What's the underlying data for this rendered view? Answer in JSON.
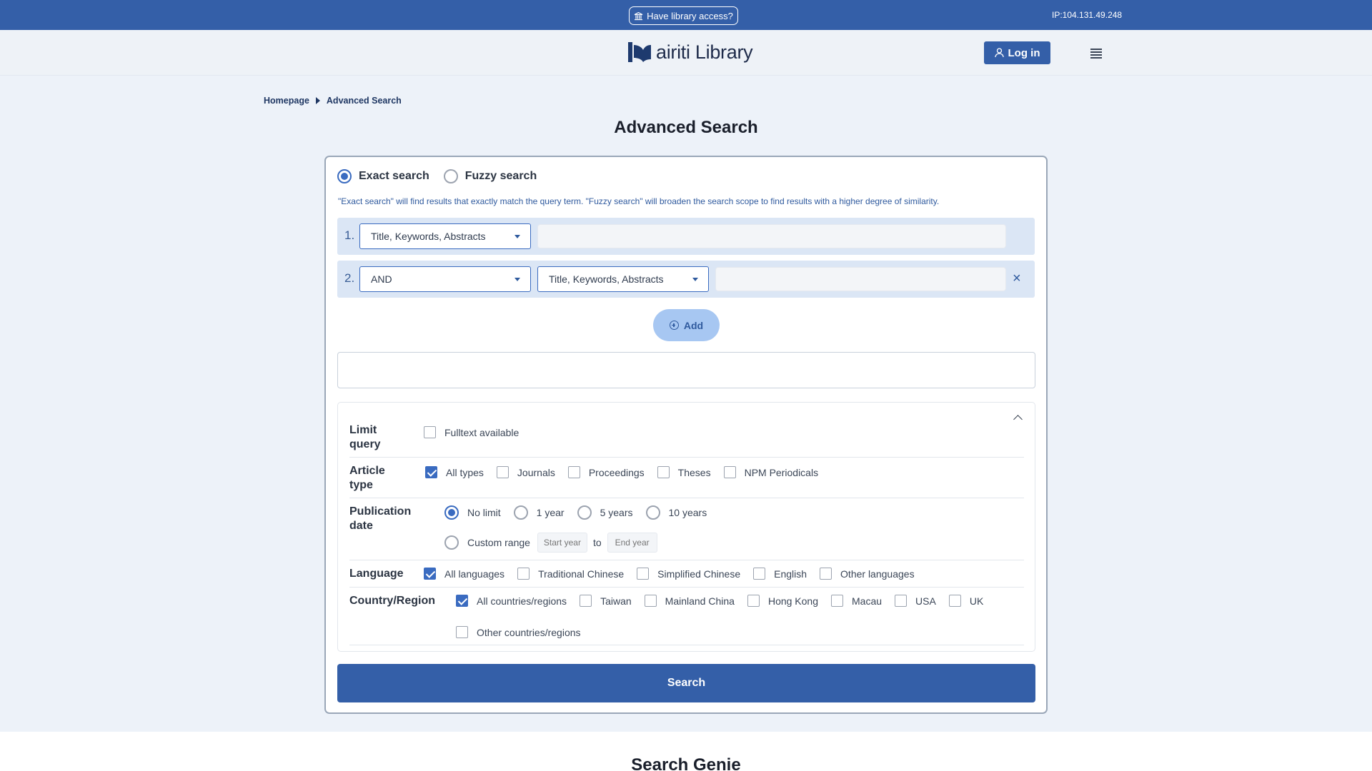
{
  "topbar": {
    "library_access": "Have library access?",
    "ip": "IP:104.131.49.248"
  },
  "header": {
    "logo_text": "airiti Library",
    "login": "Log in"
  },
  "breadcrumb": {
    "home": "Homepage",
    "current": "Advanced Search"
  },
  "page_title": "Advanced Search",
  "search_mode": {
    "exact": "Exact search",
    "fuzzy": "Fuzzy search",
    "selected": "exact",
    "hint": "\"Exact search\" will find results that exactly match the query term. \"Fuzzy search\" will broaden the search scope to find results with a higher degree of similarity."
  },
  "queries": [
    {
      "number": "1.",
      "field": "Title, Keywords, Abstracts",
      "value": ""
    },
    {
      "number": "2.",
      "operator": "AND",
      "field": "Title, Keywords, Abstracts",
      "value": ""
    }
  ],
  "add_label": "Add",
  "filters": {
    "limit_query": {
      "label": "Limit query",
      "options": [
        {
          "label": "Fulltext available",
          "checked": false
        }
      ]
    },
    "article_type": {
      "label": "Article type",
      "options": [
        {
          "label": "All types",
          "checked": true
        },
        {
          "label": "Journals",
          "checked": false
        },
        {
          "label": "Proceedings",
          "checked": false
        },
        {
          "label": "Theses",
          "checked": false
        },
        {
          "label": "NPM Periodicals",
          "checked": false
        }
      ]
    },
    "publication_date": {
      "label": "Publication date",
      "options": [
        {
          "label": "No limit",
          "selected": true
        },
        {
          "label": "1 year",
          "selected": false
        },
        {
          "label": "5 years",
          "selected": false
        },
        {
          "label": "10 years",
          "selected": false
        }
      ],
      "custom_range": "Custom range",
      "start_placeholder": "Start year",
      "to": "to",
      "end_placeholder": "End year"
    },
    "language": {
      "label": "Language",
      "options": [
        {
          "label": "All languages",
          "checked": true
        },
        {
          "label": "Traditional Chinese",
          "checked": false
        },
        {
          "label": "Simplified Chinese",
          "checked": false
        },
        {
          "label": "English",
          "checked": false
        },
        {
          "label": "Other languages",
          "checked": false
        }
      ]
    },
    "country_region": {
      "label": "Country/Region",
      "options": [
        {
          "label": "All countries/regions",
          "checked": true
        },
        {
          "label": "Taiwan",
          "checked": false
        },
        {
          "label": "Mainland China",
          "checked": false
        },
        {
          "label": "Hong Kong",
          "checked": false
        },
        {
          "label": "Macau",
          "checked": false
        },
        {
          "label": "USA",
          "checked": false
        },
        {
          "label": "UK",
          "checked": false
        }
      ],
      "other": {
        "label": "Other countries/regions",
        "checked": false
      }
    }
  },
  "search_button": "Search",
  "genie_title": "Search Genie"
}
